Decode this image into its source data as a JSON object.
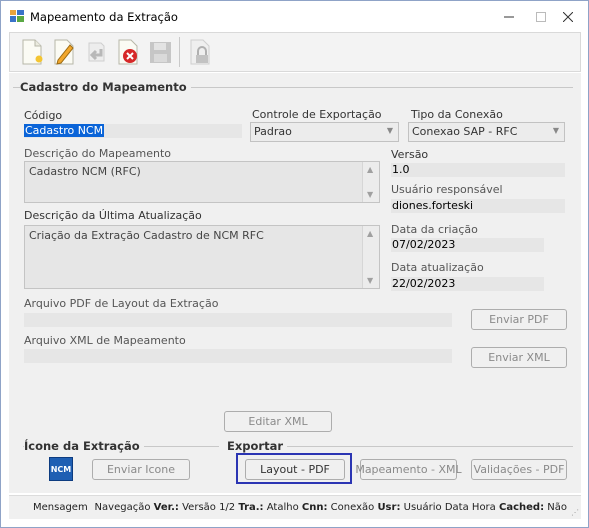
{
  "window": {
    "title": "Mapeamento da Extração"
  },
  "toolbar": {
    "buttons": [
      {
        "icon": "new-document-icon"
      },
      {
        "icon": "edit-pencil-icon"
      },
      {
        "icon": "undo-arrow-icon"
      },
      {
        "icon": "delete-icon"
      },
      {
        "icon": "save-disk-icon"
      },
      {
        "icon": "lock-icon"
      }
    ]
  },
  "cadastro": {
    "title": "Cadastro do Mapeamento",
    "codigo_label": "Código",
    "codigo_value": "Cadastro NCM",
    "controle_label": "Controle de Exportação",
    "controle_value": "Padrao",
    "tipo_label": "Tipo da Conexão",
    "tipo_value": "Conexao SAP - RFC",
    "descricao_label": "Descrição do Mapeamento",
    "descricao_value": "Cadastro NCM (RFC)",
    "versao_label": "Versão",
    "versao_value": "1.0",
    "usuario_label": "Usuário responsável",
    "usuario_value": "diones.forteski",
    "ultima_label": "Descrição da Última Atualização",
    "ultima_value": "Criação da Extração Cadastro de NCM RFC",
    "criacao_label": "Data da criação",
    "criacao_value": "07/02/2023",
    "atualizacao_label": "Data atualização",
    "atualizacao_value": "22/02/2023",
    "pdf_label": "Arquivo PDF de Layout da Extração",
    "pdf_value": "",
    "xml_label": "Arquivo XML de Mapeamento",
    "xml_value": "",
    "enviar_pdf": "Enviar PDF",
    "enviar_xml": "Enviar XML",
    "editar_xml": "Editar XML"
  },
  "icone": {
    "title": "Ícone da Extração",
    "icon_text": "NCM",
    "enviar_icone": "Enviar Icone"
  },
  "exportar": {
    "title": "Exportar",
    "layout_pdf": "Layout - PDF",
    "mapeamento_xml": "Mapeamento - XML",
    "validacoes_pdf": "Validações - PDF"
  },
  "status": {
    "mensagem": "Mensagem",
    "navegacao": "Navegação",
    "ver_label": "Ver.:",
    "ver_value": "Versão 1/2",
    "tra_label": "Tra.:",
    "tra_value": "Atalho",
    "cnn_label": "Cnn:",
    "cnn_value": "Conexão",
    "usr_label": "Usr:",
    "usr_value": "Usuário",
    "data": "Data",
    "hora": "Hora",
    "cached_label": "Cached:",
    "cached_value": "Não"
  },
  "colors": {
    "selection": "#0a64d8",
    "highlight_border": "#2b35b3",
    "background": "#f0f0f0"
  }
}
